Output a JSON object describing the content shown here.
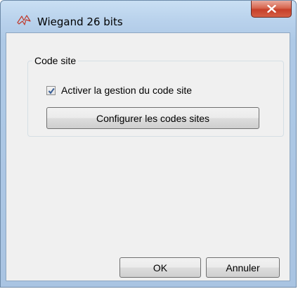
{
  "window": {
    "title": "Wiegand 26 bits",
    "icon": "wiegand-app-icon",
    "close_icon": "close-icon"
  },
  "group": {
    "legend": "Code site",
    "checkbox": {
      "label": "Activer la gestion du code site",
      "checked": true
    },
    "configure_button_label": "Configurer les codes sites"
  },
  "footer": {
    "ok_label": "OK",
    "cancel_label": "Annuler"
  },
  "colors": {
    "close_button": "#c6402a",
    "titlebar": "#b9d2ec",
    "dialog_background": "#f0f0f0",
    "check_mark": "#3a5f96"
  }
}
